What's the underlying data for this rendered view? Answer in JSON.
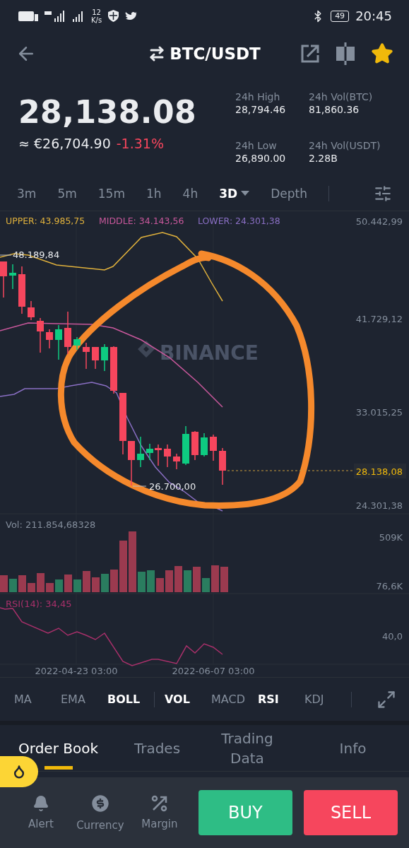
{
  "status_bar": {
    "network_speed": "12",
    "network_speed_unit": "K/s",
    "battery": "49",
    "time": "20:45"
  },
  "header": {
    "pair": "BTC/USDT",
    "favorite": true
  },
  "price": {
    "last": "28,138.08",
    "fiat": "≈ €26,704.90",
    "change": "-1.31%"
  },
  "stats": [
    {
      "label": "24h High",
      "value": "28,794.46"
    },
    {
      "label": "24h Vol(BTC)",
      "value": "81,860.36"
    },
    {
      "label": "24h Low",
      "value": "26,890.00"
    },
    {
      "label": "24h Vol(USDT)",
      "value": "2.28B"
    }
  ],
  "intervals": [
    {
      "label": "3m",
      "selected": false,
      "kind": "interval"
    },
    {
      "label": "5m",
      "selected": false,
      "kind": "interval"
    },
    {
      "label": "15m",
      "selected": false,
      "kind": "interval"
    },
    {
      "label": "1h",
      "selected": false,
      "kind": "interval"
    },
    {
      "label": "4h",
      "selected": false,
      "kind": "interval"
    },
    {
      "label": "3D",
      "selected": true,
      "kind": "menu"
    },
    {
      "label": "Depth",
      "selected": false,
      "kind": "interval"
    }
  ],
  "chart": {
    "legend": [
      {
        "label": "UPPER: 43.985,75",
        "color": "#e0b13c"
      },
      {
        "label": "MIDDLE: 34.143,56",
        "color": "#c9589c"
      },
      {
        "label": "LOWER: 24.301,38",
        "color": "#8a6fc4"
      }
    ],
    "watermark": "BINANCE",
    "price_axis": [
      "50.442,99",
      "41.729,12",
      "33.015,25",
      "24.301,38"
    ],
    "high_marker": "48.189,84",
    "low_marker": "26.700,00",
    "last_price": "28.138,08"
  },
  "volume": {
    "label": "Vol: 211.854,68328",
    "axis": [
      "509K",
      "76,6K"
    ]
  },
  "rsi": {
    "label": "RSI(14): 34,45",
    "axis": [
      "40,0"
    ]
  },
  "dates": [
    "2022-04-23 03:00",
    "2022-06-07 03:00"
  ],
  "indicators": {
    "main": [
      {
        "label": "MA",
        "on": false
      },
      {
        "label": "EMA",
        "on": false
      },
      {
        "label": "BOLL",
        "on": true
      }
    ],
    "sub": [
      {
        "label": "VOL",
        "on": true
      },
      {
        "label": "MACD",
        "on": false
      },
      {
        "label": "RSI",
        "on": true
      },
      {
        "label": "KDJ",
        "on": false
      }
    ]
  },
  "tabs": [
    {
      "label": "Order Book",
      "selected": true
    },
    {
      "label": "Trades",
      "selected": false
    },
    {
      "label": "Trading Data",
      "selected": false
    },
    {
      "label": "Info",
      "selected": false
    }
  ],
  "bottom_bar": {
    "actions": [
      {
        "label": "Alert",
        "kind": "bell"
      },
      {
        "label": "Currency",
        "kind": "dollar"
      },
      {
        "label": "Margin",
        "kind": "percent"
      }
    ],
    "buy": "BUY",
    "sell": "SELL"
  }
}
